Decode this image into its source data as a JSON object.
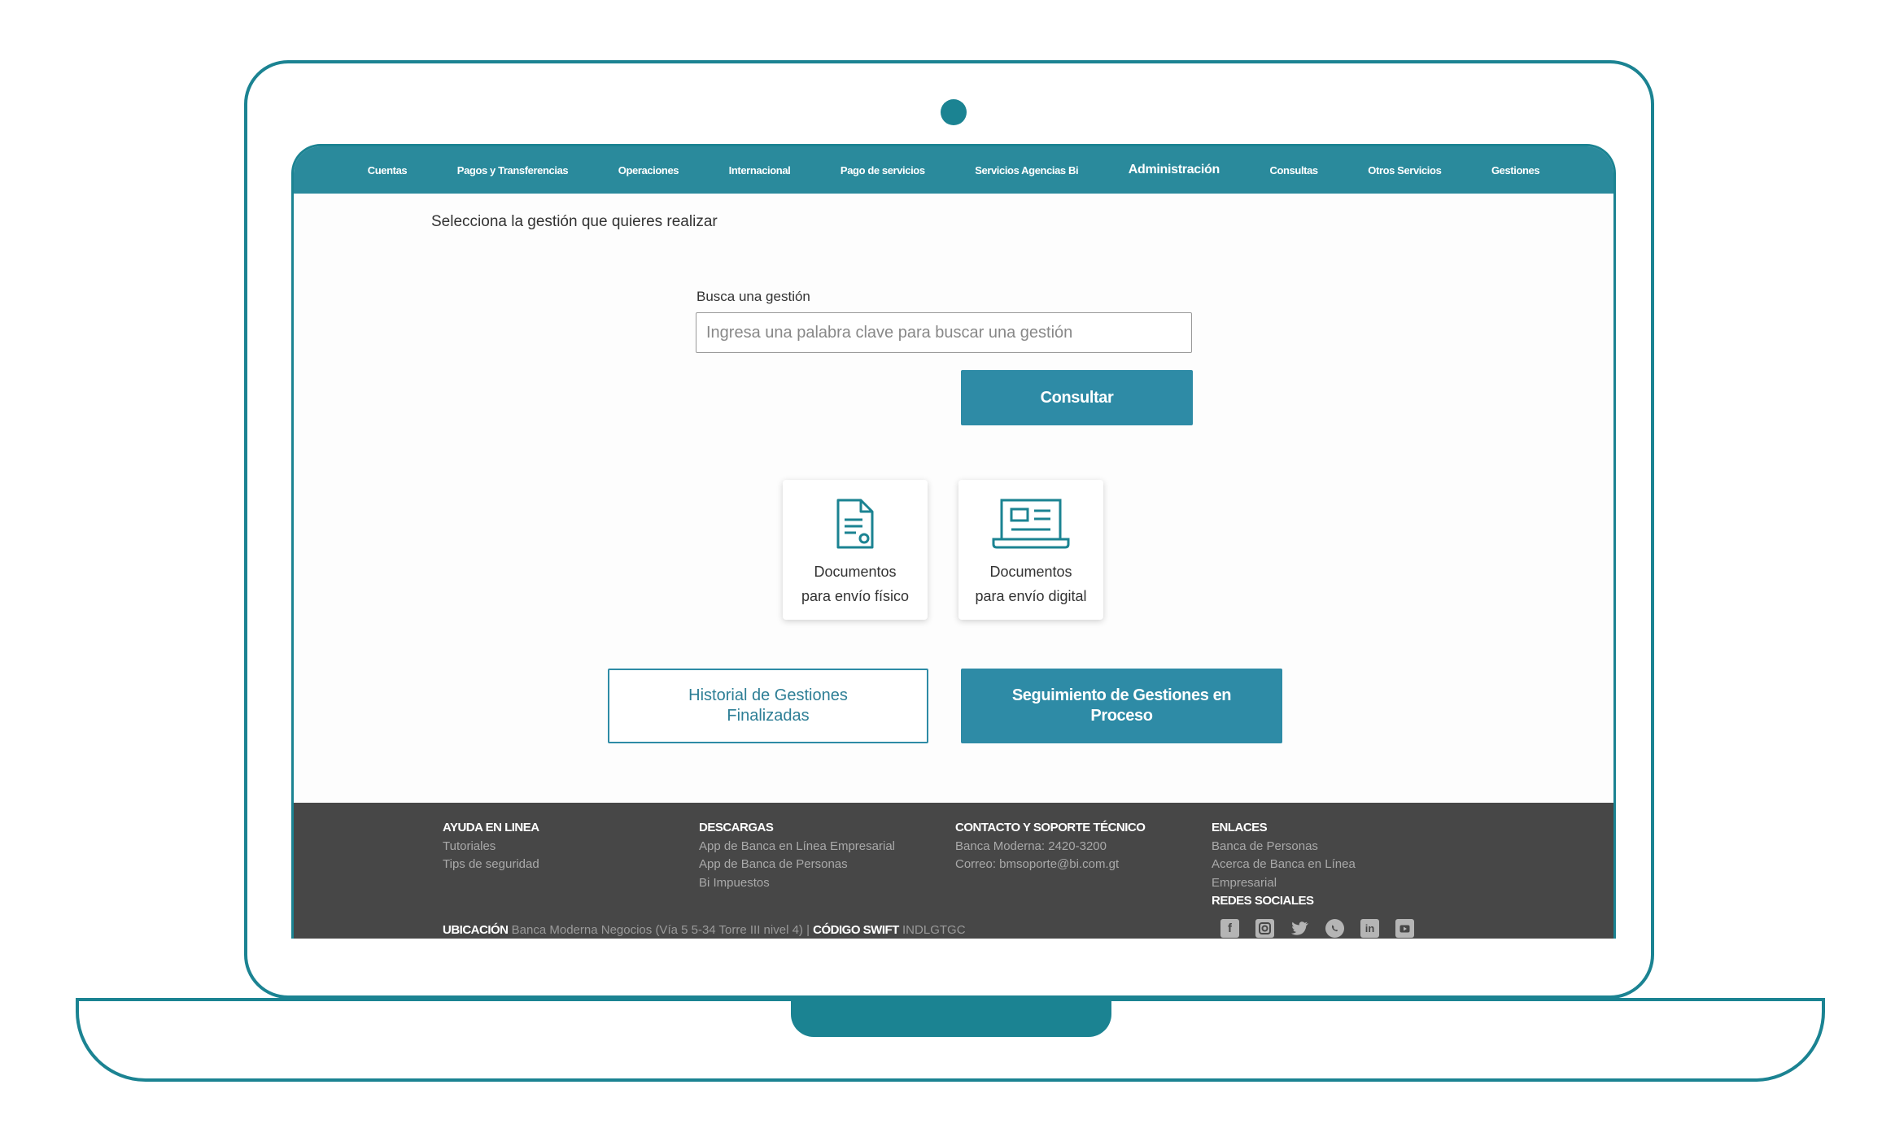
{
  "nav": {
    "items": [
      "Cuentas",
      "Pagos y Transferencias",
      "Operaciones",
      "Internacional",
      "Pago de servicios",
      "Servicios Agencias Bi",
      "Administración",
      "Consultas",
      "Otros Servicios",
      "Gestiones"
    ],
    "active": "Administración"
  },
  "page": {
    "heading": "Selecciona la gestión que quieres realizar"
  },
  "search": {
    "label": "Busca una gestión",
    "placeholder": "Ingresa una palabra clave para buscar una gestión",
    "value": "",
    "button": "Consultar"
  },
  "cards": [
    {
      "icon": "document-icon",
      "line1": "Documentos",
      "line2": "para envío físico"
    },
    {
      "icon": "laptop-document-icon",
      "line1": "Documentos",
      "line2": "para envío digital"
    }
  ],
  "buttons": {
    "history_line1": "Historial de Gestiones",
    "history_line2": "Finalizadas",
    "tracking_line1": "Seguimiento de Gestiones en",
    "tracking_line2": "Proceso"
  },
  "footer": {
    "help": {
      "title": "AYUDA EN LINEA",
      "links": [
        "Tutoriales",
        "Tips de seguridad"
      ]
    },
    "downloads": {
      "title": "DESCARGAS",
      "links": [
        "App de Banca en Línea Empresarial",
        "App de Banca de Personas",
        "Bi Impuestos"
      ]
    },
    "contact": {
      "title": "CONTACTO Y SOPORTE TÉCNICO",
      "lines": [
        "Banca Moderna: 2420-3200",
        "Correo: bmsoporte@bi.com.gt"
      ]
    },
    "links": {
      "title": "ENLACES",
      "items": [
        "Banca de Personas",
        "Acerca de Banca en Línea",
        "Empresarial"
      ]
    },
    "social_title": "REDES SOCIALES",
    "social_icons": [
      "facebook-icon",
      "instagram-icon",
      "twitter-icon",
      "whatsapp-icon",
      "linkedin-icon",
      "youtube-icon"
    ],
    "location_label": "UBICACIÓN",
    "location_value": "Banca Moderna Negocios (Vía 5 5-34 Torre III nivel 4)",
    "separator": "|",
    "swift_label": "CÓDIGO SWIFT",
    "swift_value": "INDLGTGC"
  },
  "colors": {
    "brand": "#1b8392",
    "button": "#2e8ba6",
    "nav": "#2a8a9c",
    "footer": "#474747"
  }
}
